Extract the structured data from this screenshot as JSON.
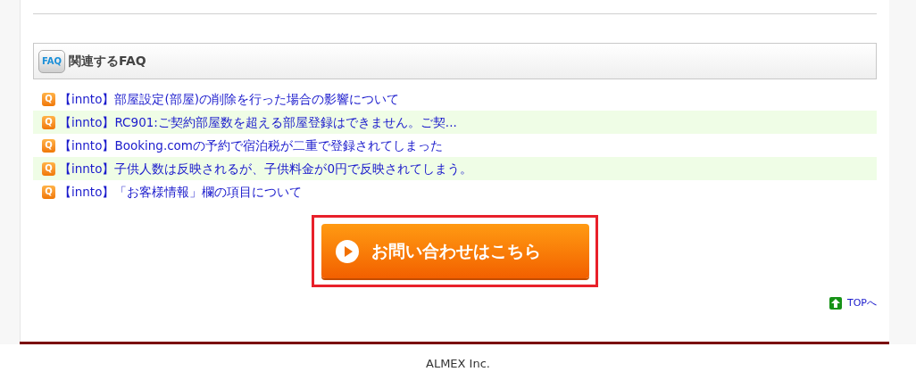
{
  "faq": {
    "icon_label": "FAQ",
    "title": "関連するFAQ",
    "items": [
      {
        "badge": "Q",
        "text": "【innto】部屋設定(部屋)の削除を行った場合の影響について"
      },
      {
        "badge": "Q",
        "text": "【innto】RC901:ご契約部屋数を超える部屋登録はできません。ご契..."
      },
      {
        "badge": "Q",
        "text": "【innto】Booking.comの予約で宿泊税が二重で登録されてしまった"
      },
      {
        "badge": "Q",
        "text": "【innto】子供人数は反映されるが、子供料金が0円で反映されてしまう。"
      },
      {
        "badge": "Q",
        "text": "【innto】「お客様情報」欄の項目について"
      }
    ]
  },
  "contact_button": {
    "label": "お問い合わせはこちら"
  },
  "top_link": "TOPへ",
  "footer": "ALMEX Inc."
}
